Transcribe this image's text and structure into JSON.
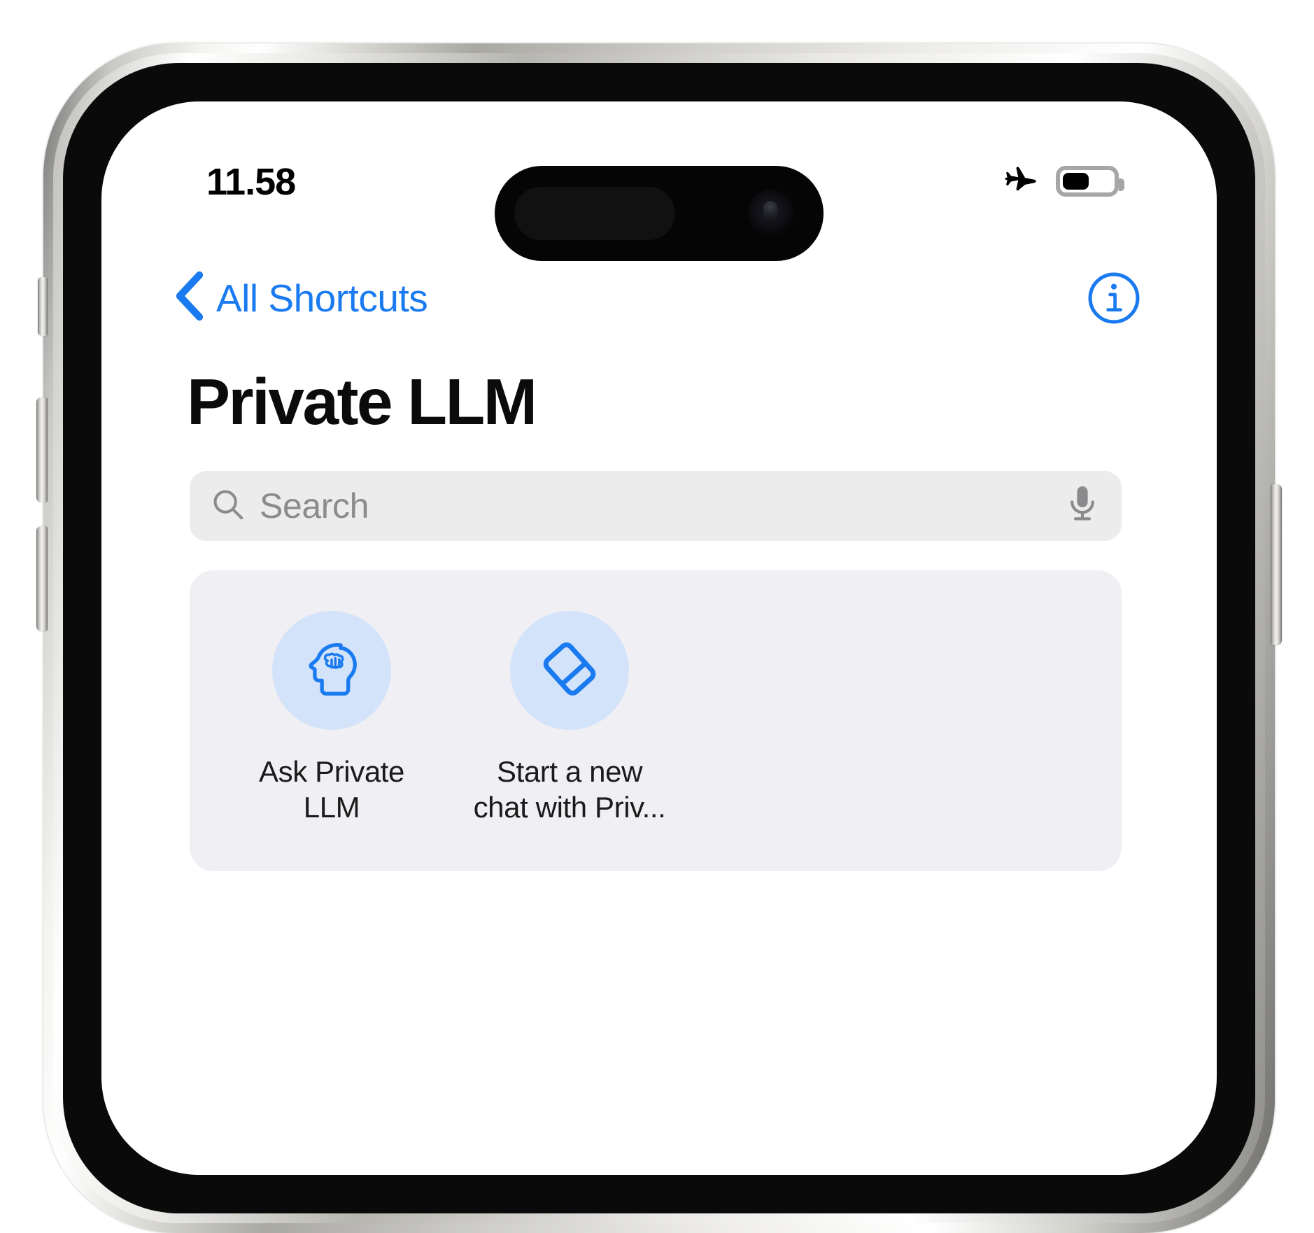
{
  "status_bar": {
    "time": "11.58",
    "airplane_icon": "airplane-mode-icon",
    "battery_icon": "battery-icon",
    "battery_level_percent": 48
  },
  "nav": {
    "back_label": "All Shortcuts",
    "back_icon": "chevron-left-icon",
    "info_icon": "info-circle-icon"
  },
  "page": {
    "title": "Private LLM"
  },
  "search": {
    "placeholder": "Search",
    "value": "",
    "search_icon": "search-icon",
    "mic_icon": "microphone-icon"
  },
  "shortcuts": {
    "items": [
      {
        "label": "Ask Private LLM",
        "icon": "head-brain-icon",
        "icon_color": "#1a7af0",
        "circle_color": "#d3e3fa"
      },
      {
        "label": "Start a new chat with Priv...",
        "icon": "eraser-icon",
        "icon_color": "#1a7af0",
        "circle_color": "#d3e3fa"
      }
    ]
  },
  "colors": {
    "accent_blue": "#1a7af0",
    "card_background": "#f0f0f4",
    "search_background": "#ececec",
    "placeholder_text": "#8b8b8d"
  },
  "device": {
    "side_buttons": [
      "silent-switch",
      "volume-up-button",
      "volume-down-button",
      "power-button"
    ],
    "dynamic_island": "dynamic-island"
  }
}
